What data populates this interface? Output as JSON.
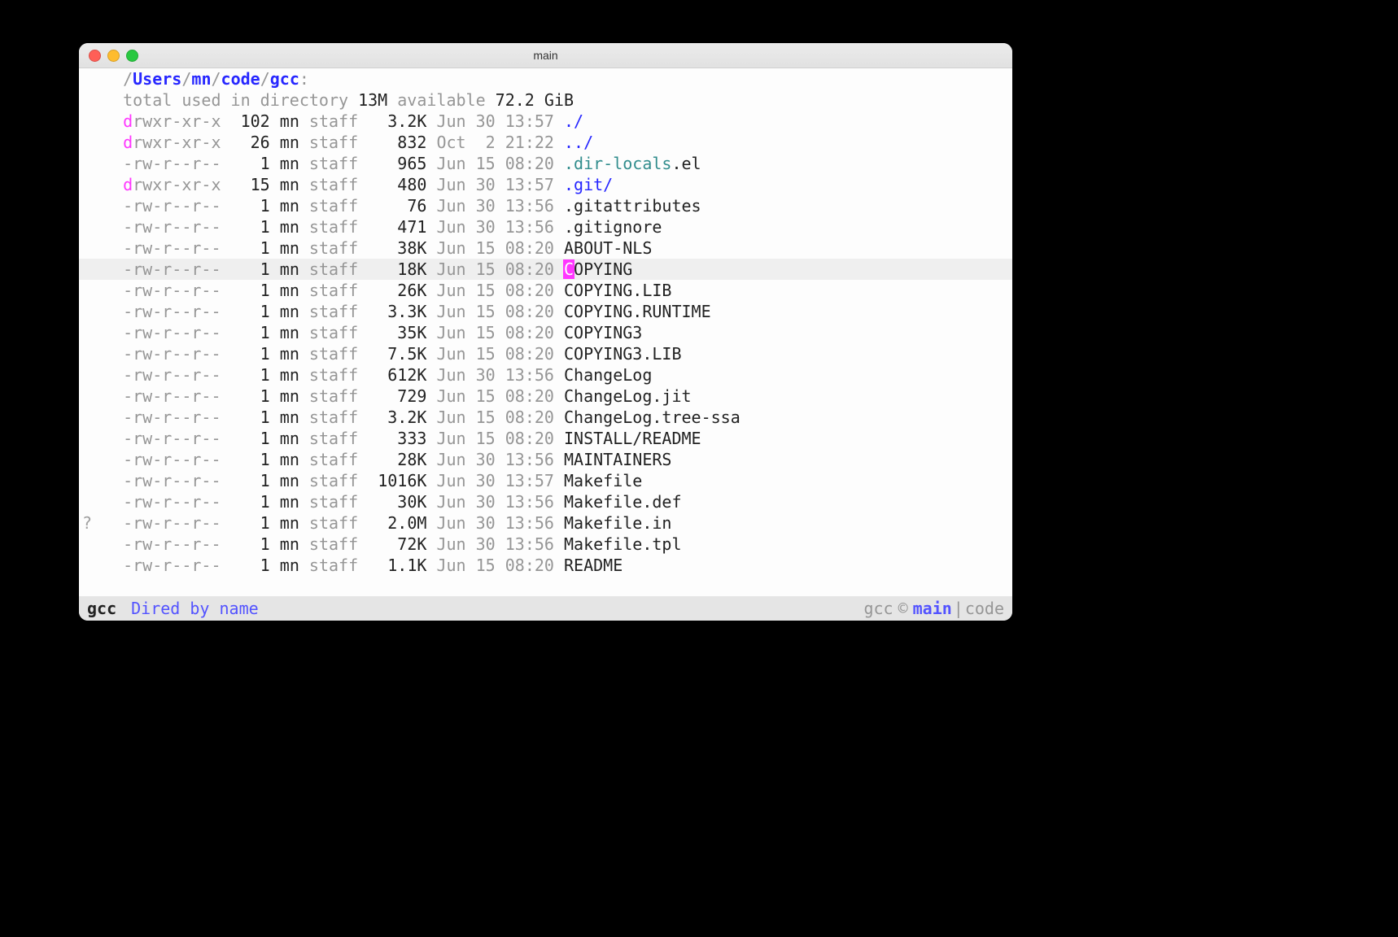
{
  "window": {
    "title": "main"
  },
  "path": {
    "leading_slash": "/",
    "segments": [
      {
        "text": "Users",
        "style": "blue"
      },
      {
        "text": "/",
        "style": "gray"
      },
      {
        "text": "mn",
        "style": "blue"
      },
      {
        "text": "/",
        "style": "gray"
      },
      {
        "text": "code",
        "style": "blue"
      },
      {
        "text": "/",
        "style": "gray"
      },
      {
        "text": "gcc",
        "style": "blue"
      },
      {
        "text": ":",
        "style": "gray"
      }
    ]
  },
  "summary": {
    "prefix": "total used in directory ",
    "used": "13M",
    "available_label": " available ",
    "available": "72.2 GiB"
  },
  "columns": {
    "perm": 10,
    "links": 5,
    "user": 3,
    "group": 6,
    "size": 6,
    "date": 13
  },
  "highlight_index": 7,
  "cursor": {
    "line": 7,
    "first_char": "C",
    "rest": "OPYING"
  },
  "fringe": {
    "mark_line": 19,
    "mark_char": "?"
  },
  "entries": [
    {
      "d": true,
      "perm": "drwxr-xr-x",
      "links": "102",
      "user": "mn",
      "group": "staff",
      "size": "3.2K",
      "date": "Jun 30 13:57",
      "name": "./",
      "name_style": "bluep"
    },
    {
      "d": true,
      "perm": "drwxr-xr-x",
      "links": "26",
      "user": "mn",
      "group": "staff",
      "size": "832",
      "date": "Oct  2 21:22",
      "name": "../",
      "name_style": "bluep"
    },
    {
      "d": false,
      "perm": "-rw-r--r--",
      "links": "1",
      "user": "mn",
      "group": "staff",
      "size": "965",
      "date": "Jun 15 08:20",
      "name_parts": [
        {
          "t": ".dir-locals",
          "s": "teal"
        },
        {
          "t": ".el",
          "s": "text"
        }
      ]
    },
    {
      "d": true,
      "perm": "drwxr-xr-x",
      "links": "15",
      "user": "mn",
      "group": "staff",
      "size": "480",
      "date": "Jun 30 13:57",
      "name_parts": [
        {
          "t": ".git",
          "s": "bluep"
        },
        {
          "t": "/",
          "s": "bluep"
        }
      ]
    },
    {
      "d": false,
      "perm": "-rw-r--r--",
      "links": "1",
      "user": "mn",
      "group": "staff",
      "size": "76",
      "date": "Jun 30 13:56",
      "name": ".gitattributes"
    },
    {
      "d": false,
      "perm": "-rw-r--r--",
      "links": "1",
      "user": "mn",
      "group": "staff",
      "size": "471",
      "date": "Jun 30 13:56",
      "name": ".gitignore"
    },
    {
      "d": false,
      "perm": "-rw-r--r--",
      "links": "1",
      "user": "mn",
      "group": "staff",
      "size": "38K",
      "date": "Jun 15 08:20",
      "name": "ABOUT-NLS"
    },
    {
      "d": false,
      "perm": "-rw-r--r--",
      "links": "1",
      "user": "mn",
      "group": "staff",
      "size": "18K",
      "date": "Jun 15 08:20",
      "name": "COPYING"
    },
    {
      "d": false,
      "perm": "-rw-r--r--",
      "links": "1",
      "user": "mn",
      "group": "staff",
      "size": "26K",
      "date": "Jun 15 08:20",
      "name": "COPYING.LIB"
    },
    {
      "d": false,
      "perm": "-rw-r--r--",
      "links": "1",
      "user": "mn",
      "group": "staff",
      "size": "3.3K",
      "date": "Jun 15 08:20",
      "name": "COPYING.RUNTIME"
    },
    {
      "d": false,
      "perm": "-rw-r--r--",
      "links": "1",
      "user": "mn",
      "group": "staff",
      "size": "35K",
      "date": "Jun 15 08:20",
      "name": "COPYING3"
    },
    {
      "d": false,
      "perm": "-rw-r--r--",
      "links": "1",
      "user": "mn",
      "group": "staff",
      "size": "7.5K",
      "date": "Jun 15 08:20",
      "name": "COPYING3.LIB"
    },
    {
      "d": false,
      "perm": "-rw-r--r--",
      "links": "1",
      "user": "mn",
      "group": "staff",
      "size": "612K",
      "date": "Jun 30 13:56",
      "name": "ChangeLog"
    },
    {
      "d": false,
      "perm": "-rw-r--r--",
      "links": "1",
      "user": "mn",
      "group": "staff",
      "size": "729",
      "date": "Jun 15 08:20",
      "name": "ChangeLog.jit"
    },
    {
      "d": false,
      "perm": "-rw-r--r--",
      "links": "1",
      "user": "mn",
      "group": "staff",
      "size": "3.2K",
      "date": "Jun 15 08:20",
      "name": "ChangeLog.tree-ssa"
    },
    {
      "d": false,
      "perm": "-rw-r--r--",
      "links": "1",
      "user": "mn",
      "group": "staff",
      "size": "333",
      "date": "Jun 15 08:20",
      "name": "INSTALL/README"
    },
    {
      "d": false,
      "perm": "-rw-r--r--",
      "links": "1",
      "user": "mn",
      "group": "staff",
      "size": "28K",
      "date": "Jun 30 13:56",
      "name": "MAINTAINERS"
    },
    {
      "d": false,
      "perm": "-rw-r--r--",
      "links": "1",
      "user": "mn",
      "group": "staff",
      "size": "1016K",
      "date": "Jun 30 13:57",
      "name": "Makefile"
    },
    {
      "d": false,
      "perm": "-rw-r--r--",
      "links": "1",
      "user": "mn",
      "group": "staff",
      "size": "30K",
      "date": "Jun 30 13:56",
      "name": "Makefile.def"
    },
    {
      "d": false,
      "perm": "-rw-r--r--",
      "links": "1",
      "user": "mn",
      "group": "staff",
      "size": "2.0M",
      "date": "Jun 30 13:56",
      "name": "Makefile.in"
    },
    {
      "d": false,
      "perm": "-rw-r--r--",
      "links": "1",
      "user": "mn",
      "group": "staff",
      "size": "72K",
      "date": "Jun 30 13:56",
      "name": "Makefile.tpl"
    },
    {
      "d": false,
      "perm": "-rw-r--r--",
      "links": "1",
      "user": "mn",
      "group": "staff",
      "size": "1.1K",
      "date": "Jun 15 08:20",
      "name": "README"
    }
  ],
  "modeline": {
    "buffer_name": "gcc",
    "mode": "Dired by name",
    "vc_label": "gcc",
    "vc_glyph": "©",
    "branch": "main",
    "project": "code"
  }
}
